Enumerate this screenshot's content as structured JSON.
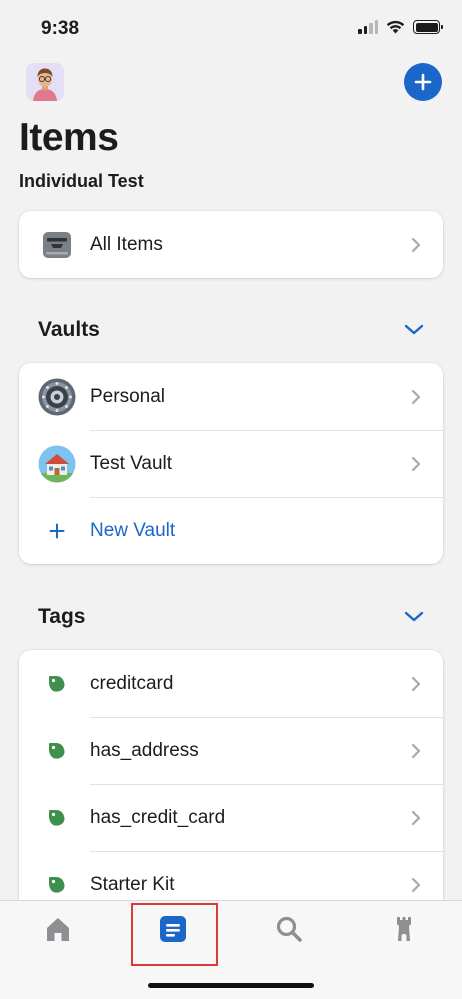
{
  "status_bar": {
    "time": "9:38"
  },
  "header": {
    "title": "Items",
    "account_name": "Individual Test"
  },
  "all_items": {
    "label": "All Items"
  },
  "vaults": {
    "title": "Vaults",
    "items": [
      {
        "label": "Personal"
      },
      {
        "label": "Test Vault"
      }
    ],
    "new_vault_label": "New Vault"
  },
  "tags": {
    "title": "Tags",
    "items": [
      {
        "label": "creditcard"
      },
      {
        "label": "has_address"
      },
      {
        "label": "has_credit_card"
      },
      {
        "label": "Starter Kit"
      }
    ]
  },
  "tab_bar": {
    "tabs": [
      {
        "icon": "home-icon",
        "selected": false
      },
      {
        "icon": "items-icon",
        "selected": true
      },
      {
        "icon": "search-icon",
        "selected": false
      },
      {
        "icon": "watchtower-icon",
        "selected": false
      }
    ]
  },
  "colors": {
    "accent": "#1a66c9",
    "tag_green": "#3f8f4e",
    "chevron": "#a8a8ad",
    "tab_inactive": "#8e8e93",
    "highlight": "#d93a3a"
  }
}
